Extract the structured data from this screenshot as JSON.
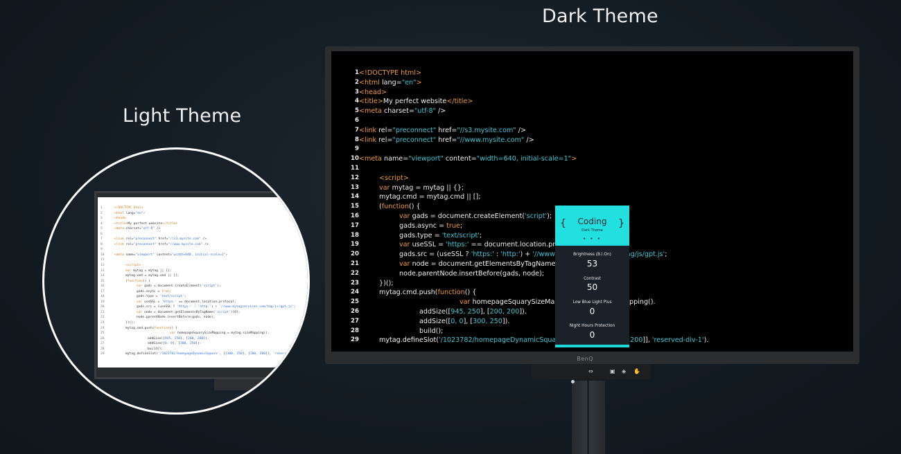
{
  "headings": {
    "dark": "Dark Theme",
    "light": "Light Theme"
  },
  "brand": "BenQ",
  "code_lines": [
    {
      "num": "1",
      "indent": 0,
      "parts": [
        [
          "tag",
          "<!DOCTYPE html>"
        ]
      ]
    },
    {
      "num": "2",
      "indent": 0,
      "parts": [
        [
          "tag",
          "<html "
        ],
        [
          "txt",
          "lang="
        ],
        [
          "str",
          "\"en\""
        ],
        [
          "tag",
          ">"
        ]
      ]
    },
    {
      "num": "3",
      "indent": 0,
      "parts": [
        [
          "tag",
          "<head>"
        ]
      ]
    },
    {
      "num": "4",
      "indent": 0,
      "parts": [
        [
          "tag",
          "<title>"
        ],
        [
          "txt",
          "My perfect website"
        ],
        [
          "tag",
          "</title>"
        ]
      ]
    },
    {
      "num": "5",
      "indent": 0,
      "parts": [
        [
          "tag",
          "<meta "
        ],
        [
          "txt",
          "charset="
        ],
        [
          "str",
          "\"utf-8\""
        ],
        [
          "txt",
          " />"
        ]
      ]
    },
    {
      "num": "6",
      "indent": 0,
      "parts": []
    },
    {
      "num": "7",
      "indent": 0,
      "parts": [
        [
          "tag",
          "<link "
        ],
        [
          "txt",
          "rel="
        ],
        [
          "str",
          "\"preconnect\""
        ],
        [
          "txt",
          " href="
        ],
        [
          "str",
          "\"//s3.mysite.com\""
        ],
        [
          "txt",
          " />"
        ]
      ]
    },
    {
      "num": "8",
      "indent": 0,
      "parts": [
        [
          "tag",
          "<link "
        ],
        [
          "txt",
          "rel="
        ],
        [
          "str",
          "\"preconnect\""
        ],
        [
          "txt",
          " href="
        ],
        [
          "str",
          "\"//www.mysite.com\""
        ],
        [
          "txt",
          " />"
        ]
      ]
    },
    {
      "num": "9",
      "indent": 0,
      "parts": []
    },
    {
      "num": "10",
      "indent": 0,
      "parts": [
        [
          "tag",
          "<meta "
        ],
        [
          "txt",
          "name="
        ],
        [
          "str",
          "\"viewport\""
        ],
        [
          "txt",
          " content="
        ],
        [
          "str",
          "\"width=640, initial-scale=1\""
        ],
        [
          "tag",
          ">"
        ]
      ]
    },
    {
      "num": "11",
      "indent": 0,
      "parts": []
    },
    {
      "num": "12",
      "indent": 1,
      "parts": [
        [
          "tag",
          "<script>"
        ]
      ]
    },
    {
      "num": "13",
      "indent": 1,
      "parts": [
        [
          "tag",
          "var "
        ],
        [
          "txt",
          "mytag = mytag || {};"
        ]
      ]
    },
    {
      "num": "14",
      "indent": 1,
      "parts": [
        [
          "txt",
          "mytag.cmd = mytag.cmd || [];"
        ]
      ]
    },
    {
      "num": "15",
      "indent": 1,
      "parts": [
        [
          "txt",
          "("
        ],
        [
          "tag",
          "function"
        ],
        [
          "txt",
          "() {"
        ]
      ]
    },
    {
      "num": "16",
      "indent": 2,
      "parts": [
        [
          "tag",
          "var "
        ],
        [
          "txt",
          "gads = document.createElement("
        ],
        [
          "str",
          "'script'"
        ],
        [
          "txt",
          ");"
        ]
      ]
    },
    {
      "num": "17",
      "indent": 2,
      "parts": [
        [
          "txt",
          "gads.async = "
        ],
        [
          "tag",
          "true"
        ],
        [
          "txt",
          ";"
        ]
      ]
    },
    {
      "num": "18",
      "indent": 2,
      "parts": [
        [
          "txt",
          "gads.type = "
        ],
        [
          "str",
          "'text/script'"
        ],
        [
          "txt",
          ";"
        ]
      ]
    },
    {
      "num": "19",
      "indent": 2,
      "parts": [
        [
          "tag",
          "var "
        ],
        [
          "txt",
          "useSSL = "
        ],
        [
          "str",
          "'https:'"
        ],
        [
          "txt",
          " == document.location.protocol;"
        ]
      ]
    },
    {
      "num": "20",
      "indent": 2,
      "parts": [
        [
          "txt",
          "gads.src = (useSSL ? "
        ],
        [
          "str",
          "'https:'"
        ],
        [
          "txt",
          " : "
        ],
        [
          "str",
          "'http:'"
        ],
        [
          "txt",
          ") + "
        ],
        [
          "str",
          "'//www.mytagservices.com/tag/js/gpt.js'"
        ],
        [
          "txt",
          ";"
        ]
      ]
    },
    {
      "num": "21",
      "indent": 2,
      "parts": [
        [
          "tag",
          "var "
        ],
        [
          "txt",
          "node = document.getElementsByTagName("
        ],
        [
          "str",
          "'script'"
        ],
        [
          "txt",
          ")[0];"
        ]
      ]
    },
    {
      "num": "22",
      "indent": 2,
      "parts": [
        [
          "txt",
          "node.parentNode.insertBefore(gads, node);"
        ]
      ]
    },
    {
      "num": "23",
      "indent": 1,
      "parts": [
        [
          "txt",
          "})();"
        ]
      ]
    },
    {
      "num": "24",
      "indent": 1,
      "parts": [
        [
          "txt",
          "mytag.cmd.push("
        ],
        [
          "tag",
          "function"
        ],
        [
          "txt",
          "() {"
        ]
      ]
    },
    {
      "num": "25",
      "indent": 5,
      "parts": [
        [
          "tag",
          "var "
        ],
        [
          "txt",
          "homepageSquarySizeMapping = mytag.sizeMapping()."
        ]
      ]
    },
    {
      "num": "26",
      "indent": 3,
      "parts": [
        [
          "txt",
          "addSize(["
        ],
        [
          "str",
          "945, 250"
        ],
        [
          "txt",
          "], ["
        ],
        [
          "str",
          "200, 200"
        ],
        [
          "txt",
          "])."
        ]
      ]
    },
    {
      "num": "27",
      "indent": 3,
      "parts": [
        [
          "txt",
          "addSize(["
        ],
        [
          "str",
          "0, 0"
        ],
        [
          "txt",
          "], ["
        ],
        [
          "str",
          "300, 250"
        ],
        [
          "txt",
          "])."
        ]
      ]
    },
    {
      "num": "28",
      "indent": 3,
      "parts": [
        [
          "txt",
          "build();"
        ]
      ]
    },
    {
      "num": "29",
      "indent": 1,
      "parts": [
        [
          "txt",
          "mytag.defineSlot("
        ],
        [
          "str",
          "'/1023782/homepageDynamicSquare'"
        ],
        [
          "txt",
          ", [["
        ],
        [
          "str",
          "300, 250"
        ],
        [
          "txt",
          "], ["
        ],
        [
          "str",
          "200, 200"
        ],
        [
          "txt",
          "]], "
        ],
        [
          "str",
          "'reserved-div-1'"
        ],
        [
          "txt",
          ")."
        ]
      ]
    }
  ],
  "osd": {
    "title": "Coding",
    "subtitle": "Dark Theme",
    "brace_left": "{",
    "brace_right": "}",
    "dots": "• • •",
    "items": [
      {
        "label": "Brightness (B.I.On)",
        "value": "53"
      },
      {
        "label": "Contrast",
        "value": "50"
      },
      {
        "label": "Low Blue Light Plus",
        "value": "0"
      },
      {
        "label": "Night Hours Protection",
        "value": "0"
      }
    ]
  },
  "controls": [
    "⇔",
    "▣",
    "◈",
    "✋"
  ],
  "colors": {
    "tag": "#f29a3a",
    "string": "#40c7d8",
    "osd_accent": "#22dfe0",
    "background": "#131b22"
  }
}
